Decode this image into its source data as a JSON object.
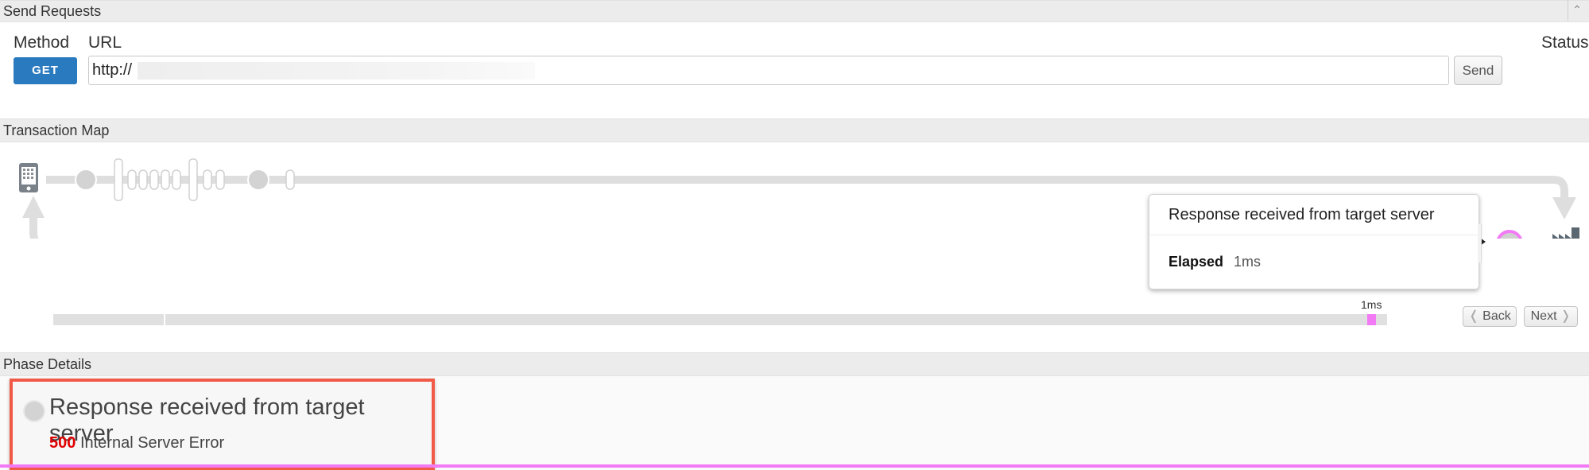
{
  "send_requests": {
    "header": "Send Requests",
    "method_label": "Method",
    "url_label": "URL",
    "status_label": "Status",
    "method_value": "GET",
    "url_value": "http://",
    "send_label": "Send"
  },
  "transaction_map": {
    "header": "Transaction Map",
    "tooltip_title": "Response received from target server",
    "tooltip_elapsed_label": "Elapsed",
    "tooltip_elapsed_value": "1ms",
    "timeline_label": "1ms",
    "back_label": "Back",
    "next_label": "Next",
    "colors": {
      "track": "#e0e0e0",
      "highlight": "#f27af5",
      "node": "#d3d3d3"
    }
  },
  "phase_details": {
    "header": "Phase Details",
    "title": "Response received from target server",
    "status_code": "500",
    "status_text": "Internal Server Error",
    "colors": {
      "status_code": "#e00000",
      "box_border": "#f25a48"
    }
  }
}
